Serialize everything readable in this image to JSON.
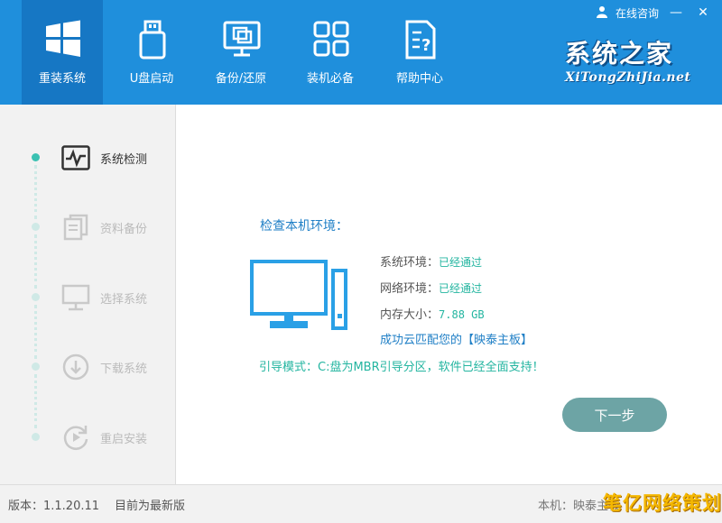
{
  "nav": [
    {
      "label": "重装系统",
      "icon": "windows-logo-icon",
      "active": true
    },
    {
      "label": "U盘启动",
      "icon": "usb-drive-icon",
      "active": false
    },
    {
      "label": "备份/还原",
      "icon": "backup-restore-icon",
      "active": false
    },
    {
      "label": "装机必备",
      "icon": "apps-grid-icon",
      "active": false
    },
    {
      "label": "帮助中心",
      "icon": "help-document-icon",
      "active": false
    }
  ],
  "window": {
    "consult_label": "在线咨询",
    "minimize": "—",
    "close": "✕"
  },
  "brand": {
    "main": "系统之家",
    "sub": "XiTongZhiJia.net"
  },
  "steps": [
    {
      "label": "系统检测",
      "icon": "monitor-pulse-icon",
      "active": true
    },
    {
      "label": "资料备份",
      "icon": "documents-icon",
      "active": false
    },
    {
      "label": "选择系统",
      "icon": "monitor-icon",
      "active": false
    },
    {
      "label": "下载系统",
      "icon": "download-circle-icon",
      "active": false
    },
    {
      "label": "重启安装",
      "icon": "restart-icon",
      "active": false
    }
  ],
  "check": {
    "heading": "检查本机环境：",
    "rows": [
      {
        "key": "系统环境：",
        "value": "已经通过"
      },
      {
        "key": "网络环境：",
        "value": "已经通过"
      },
      {
        "key": "内存大小：",
        "value": "7.88 GB"
      }
    ],
    "match_prefix": "成功云匹配您的",
    "match_name": "【映泰主板】",
    "guide": "引导模式：C:盘为MBR引导分区，软件已经全面支持！",
    "next_button": "下一步"
  },
  "footer": {
    "version": "版本：1.1.20.11",
    "latest": "目前为最新版",
    "machine": "本机：映泰主板"
  },
  "watermark": "笔亿网络策划",
  "colors": {
    "titlebar": "#1f8fdc",
    "accent_teal": "#23b5a0",
    "button": "#6da4a5",
    "heading_blue": "#1f7fc6"
  }
}
